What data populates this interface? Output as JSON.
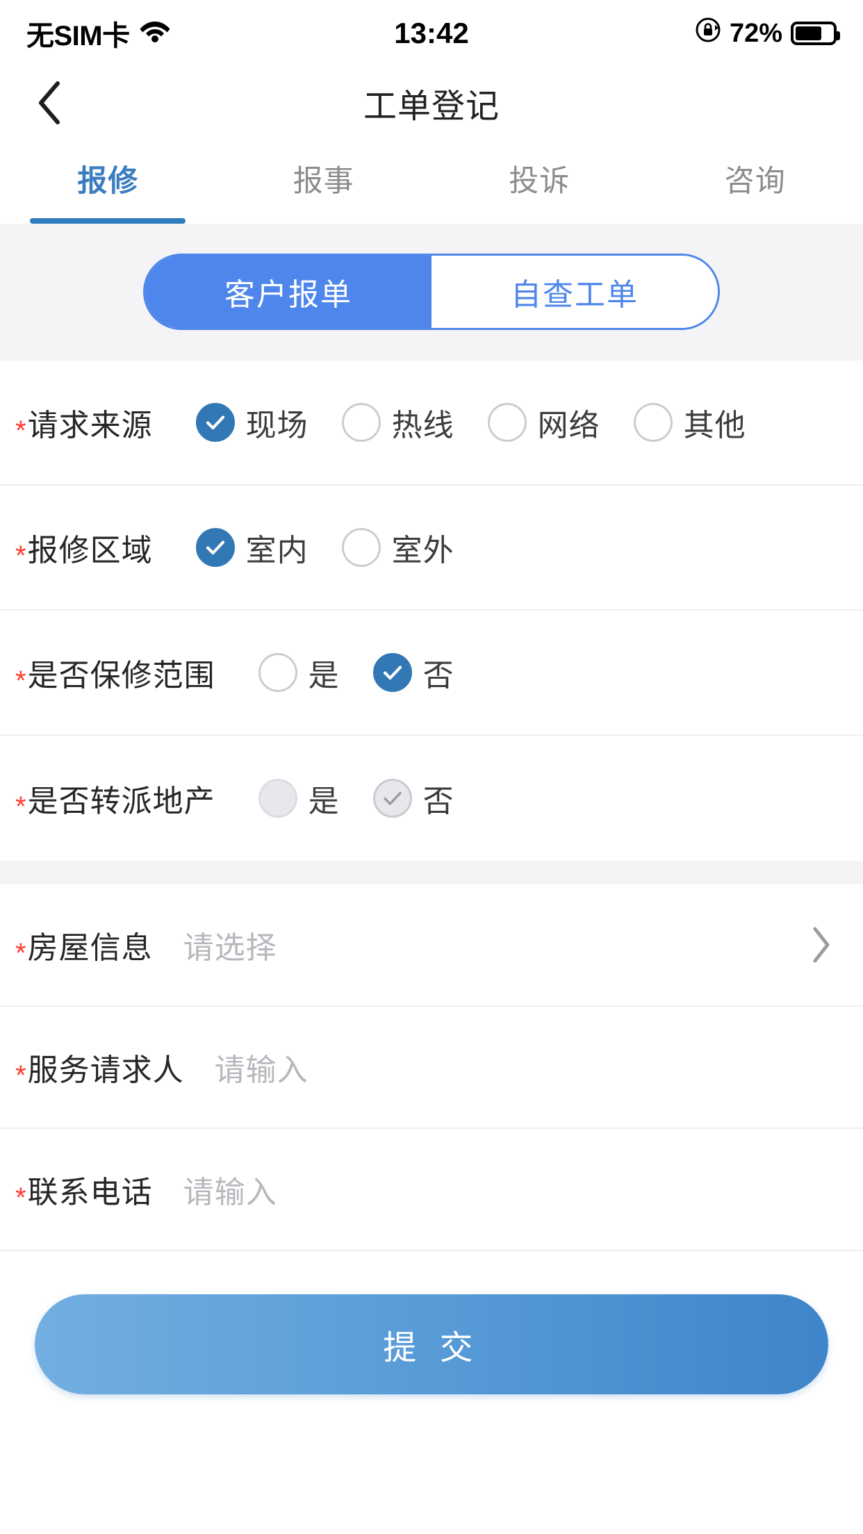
{
  "status_bar": {
    "carrier": "无SIM卡",
    "wifi_icon": "wifi-icon",
    "time": "13:42",
    "lock_icon": "rotation-lock-icon",
    "battery_percent": "72%",
    "battery_icon": "battery-icon"
  },
  "nav": {
    "back_icon": "chevron-left-icon",
    "title": "工单登记"
  },
  "tabs": [
    {
      "label": "报修",
      "active": true
    },
    {
      "label": "报事",
      "active": false
    },
    {
      "label": "投诉",
      "active": false
    },
    {
      "label": "咨询",
      "active": false
    }
  ],
  "segment": {
    "options": [
      {
        "label": "客户报单",
        "active": true
      },
      {
        "label": "自查工单",
        "active": false
      }
    ]
  },
  "form": {
    "required_mark": "*",
    "radio_rows": [
      {
        "label": "请求来源",
        "options": [
          {
            "label": "现场",
            "checked": true,
            "disabled": false
          },
          {
            "label": "热线",
            "checked": false,
            "disabled": false
          },
          {
            "label": "网络",
            "checked": false,
            "disabled": false
          },
          {
            "label": "其他",
            "checked": false,
            "disabled": false
          }
        ]
      },
      {
        "label": "报修区域",
        "options": [
          {
            "label": "室内",
            "checked": true,
            "disabled": false
          },
          {
            "label": "室外",
            "checked": false,
            "disabled": false
          }
        ]
      },
      {
        "label": "是否保修范围",
        "options": [
          {
            "label": "是",
            "checked": false,
            "disabled": false
          },
          {
            "label": "否",
            "checked": true,
            "disabled": false
          }
        ]
      },
      {
        "label": "是否转派地产",
        "options": [
          {
            "label": "是",
            "checked": false,
            "disabled": true
          },
          {
            "label": "否",
            "checked": true,
            "disabled": true
          }
        ]
      }
    ],
    "input_rows": [
      {
        "label": "房屋信息",
        "placeholder": "请选择",
        "value": "",
        "has_chevron": true,
        "chevron_icon": "chevron-right-icon"
      },
      {
        "label": "服务请求人",
        "placeholder": "请输入",
        "value": "",
        "has_chevron": false,
        "chevron_icon": ""
      },
      {
        "label": "联系电话",
        "placeholder": "请输入",
        "value": "",
        "has_chevron": false,
        "chevron_icon": ""
      }
    ]
  },
  "submit": {
    "label": "提 交"
  },
  "colors": {
    "accent_blue": "#4f86eb",
    "radio_blue": "#3178b5",
    "tab_active": "#3b7dbf",
    "required_red": "#ff3b30",
    "band_gray": "#f4f4f6",
    "placeholder_gray": "#b7b7bd",
    "submit_gradient_from": "#72aee0",
    "submit_gradient_to": "#3e86c9"
  }
}
